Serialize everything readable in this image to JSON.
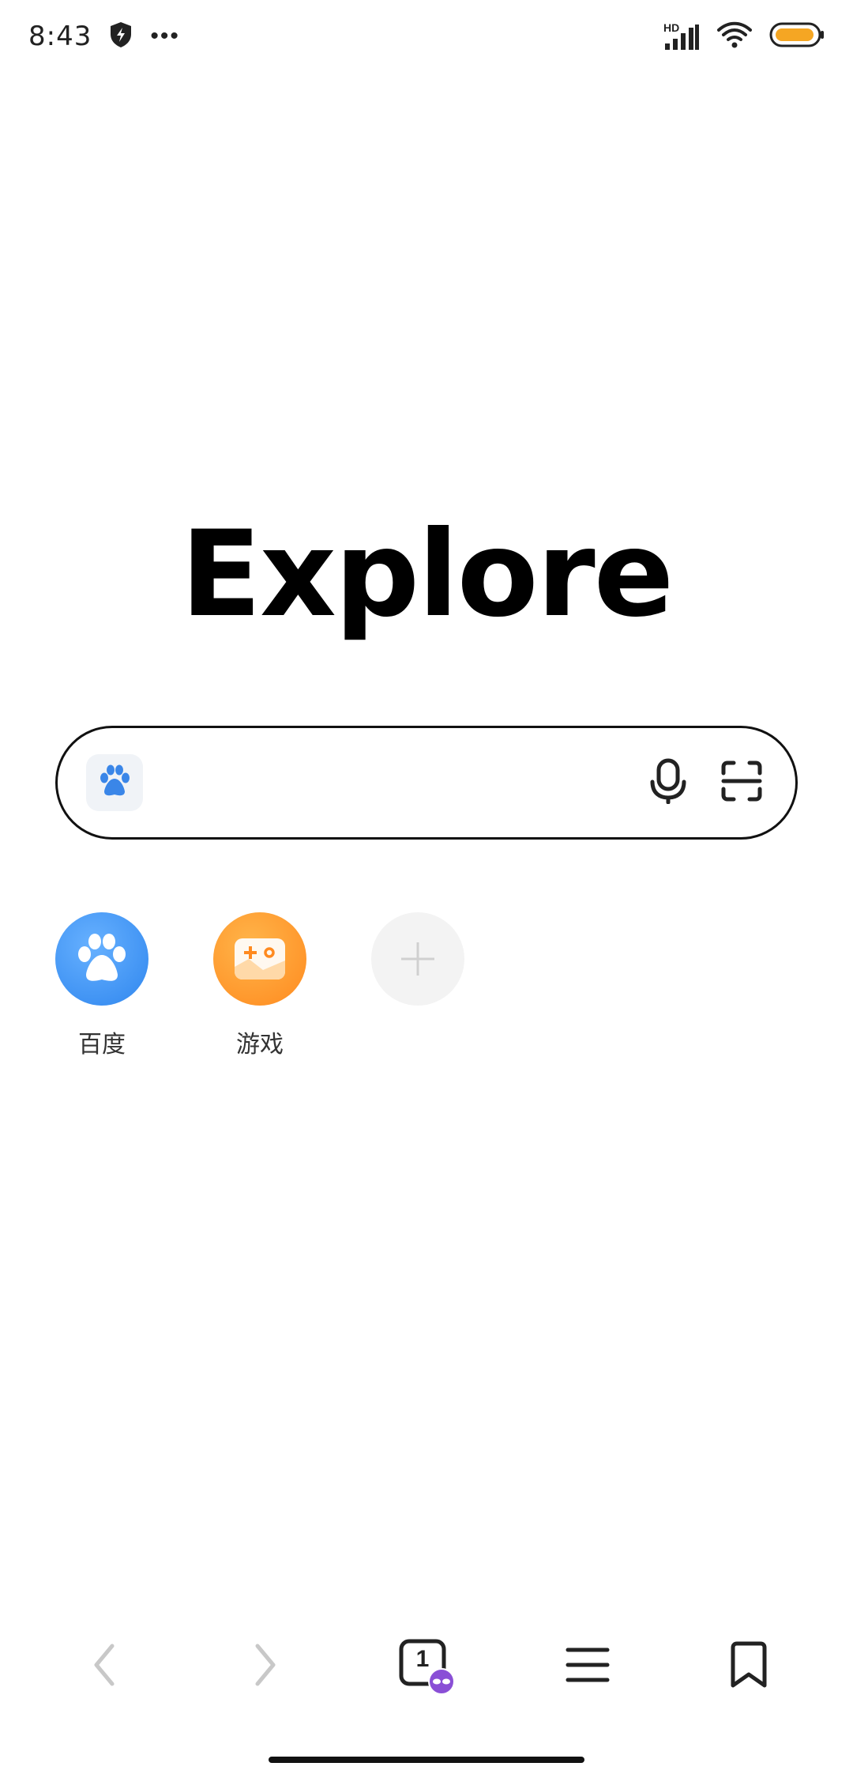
{
  "status_bar": {
    "time": "8:43",
    "network_label": "HD",
    "icons": [
      "shield-icon",
      "more-dots-icon",
      "signal-icon",
      "wifi-icon",
      "battery-icon"
    ],
    "battery_color": "#f5a623"
  },
  "logo": {
    "text": "Explore"
  },
  "search": {
    "value": "",
    "placeholder": "",
    "engine_icon": "baidu-paw-icon",
    "voice_icon": "microphone-icon",
    "scan_icon": "scan-icon"
  },
  "shortcuts": [
    {
      "label": "百度",
      "icon": "baidu-paw-icon",
      "color": "#2f86ee"
    },
    {
      "label": "游戏",
      "icon": "gamepad-icon",
      "color": "#ff8a1f"
    },
    {
      "label": "",
      "icon": "plus-icon",
      "color": "#f3f3f3"
    }
  ],
  "bottom_nav": {
    "tab_count": "1",
    "items": [
      "back-icon",
      "forward-icon",
      "tabs-icon",
      "menu-icon",
      "bookmark-icon"
    ],
    "incognito_color": "#8a4fd6"
  }
}
